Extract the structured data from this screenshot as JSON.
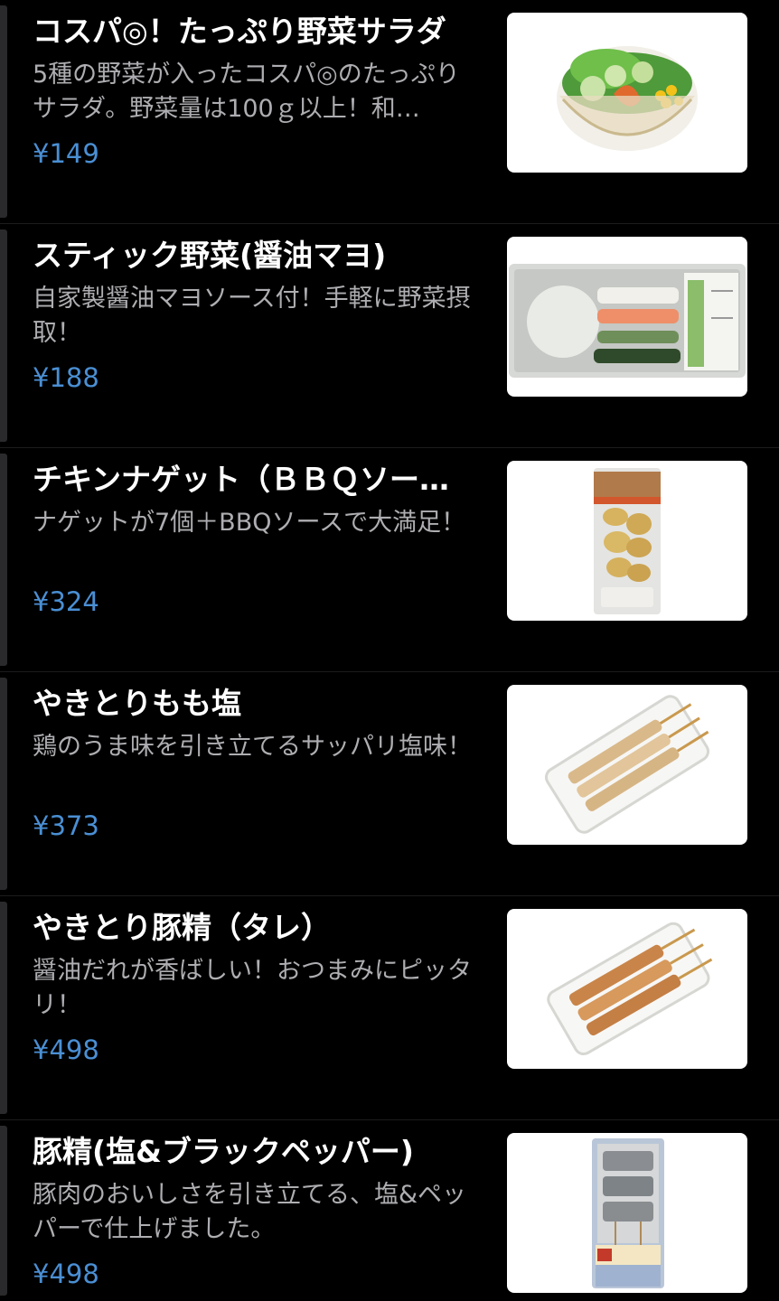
{
  "menu": {
    "items": [
      {
        "title": "コスパ◎！たっぷり野菜サラダ",
        "description": "5種の野菜が入ったコスパ◎のたっぷりサラダ。野菜量は100ｇ以上！和…",
        "price": "¥149",
        "image_icon": "salad-bowl-photo"
      },
      {
        "title": "スティック野菜(醤油マヨ)",
        "description": "自家製醤油マヨソース付！手軽に野菜摂取！",
        "price": "¥188",
        "image_icon": "vegetable-sticks-photo"
      },
      {
        "title": "チキンナゲット（ＢＢＱソー…",
        "description": "ナゲットが7個＋BBQソースで大満足！",
        "price": "¥324",
        "image_icon": "chicken-nuggets-photo"
      },
      {
        "title": "やきとりもも塩",
        "description": "鶏のうま味を引き立てるサッパリ塩味！",
        "price": "¥373",
        "image_icon": "yakitori-salt-photo"
      },
      {
        "title": "やきとり豚精（タレ）",
        "description": "醤油だれが香ばしい！おつまみにピッタリ！",
        "price": "¥498",
        "image_icon": "yakitori-tare-photo"
      },
      {
        "title": "豚精(塩&ブラックペッパー)",
        "description": "豚肉のおいしさを引き立てる、塩&ペッパーで仕上げました。",
        "price": "¥498",
        "image_icon": "pork-skewer-pepper-photo"
      }
    ]
  },
  "colors": {
    "background": "#000000",
    "title": "#ffffff",
    "description": "#aeaeb2",
    "price": "#4a8fd4",
    "divider": "#1c1c1e"
  }
}
